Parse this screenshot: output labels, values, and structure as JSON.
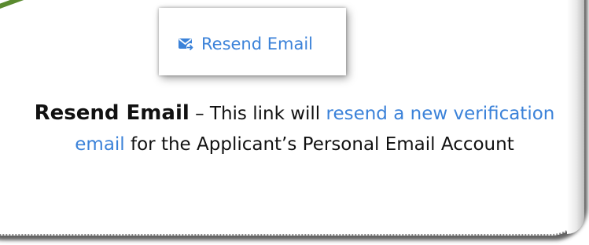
{
  "snapshot": {
    "resend_label": "Resend Email",
    "icon": "email-forward-icon"
  },
  "description": {
    "term": "Resend Email",
    "dash": " – This link will ",
    "highlight": "resend a new verification email",
    "rest": " for the Applicant’s Personal Email Account"
  },
  "colors": {
    "link": "#3b82d9",
    "connector": "#5a8a2f"
  }
}
